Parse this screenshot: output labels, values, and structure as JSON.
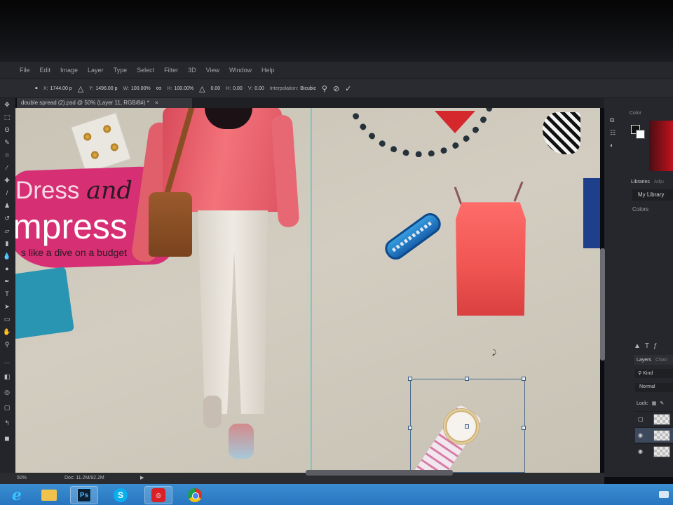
{
  "menu": [
    "File",
    "Edit",
    "Image",
    "Layer",
    "Type",
    "Select",
    "Filter",
    "3D",
    "View",
    "Window",
    "Help"
  ],
  "options": {
    "x_label": "X:",
    "x_value": "1744.00 p",
    "y_label": "Y:",
    "y_value": "1496.00 p",
    "w_label": "W:",
    "w_value": "100.00%",
    "h_label": "H:",
    "h_value": "100.00%",
    "angle_value": "0.00",
    "hskew_label": "H:",
    "hskew_value": "0.00",
    "vskew_label": "V:",
    "vskew_value": "0.00",
    "interp_label": "Interpolation:",
    "interp_value": "Bicubic"
  },
  "document": {
    "tab_title": "double spread (2).psd @ 50% (Layer 11, RGB/8#) *",
    "tab_close": "×"
  },
  "canvas_text": {
    "title_word1": "Dress",
    "title_word2": "and",
    "title_line2": "mpress",
    "subtitle": "s like a dive on a budget"
  },
  "panels": {
    "color_tab": "Color",
    "libraries_tab": "Libraries",
    "adjust_tab": "Adju",
    "library_name": "My Library",
    "colors_section": "Colors",
    "layers_tab": "Layers",
    "channels_tab": "Chan",
    "kind_filter": "Kind",
    "blend_mode": "Normal",
    "lock_label": "Lock:"
  },
  "status": {
    "zoom": "50%",
    "doc_size": "Doc: 11.2M/92.2M"
  },
  "taskbar": {
    "ps_label": "Ps",
    "skype_label": "S"
  }
}
